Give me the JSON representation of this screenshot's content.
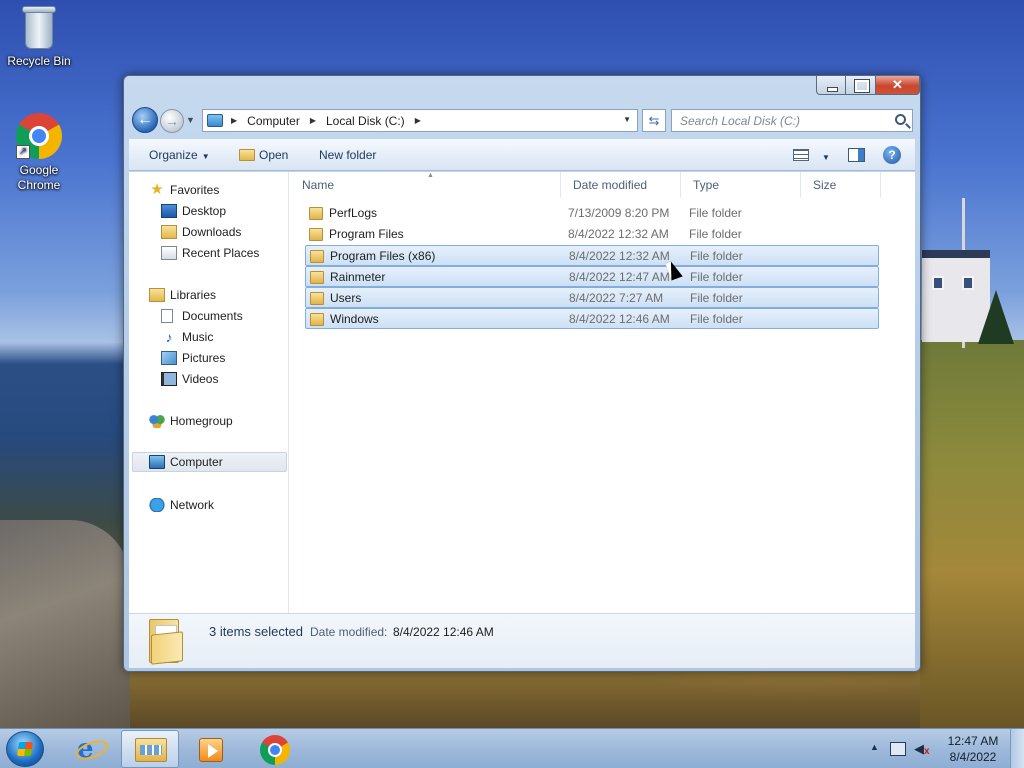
{
  "desktop": {
    "icons": [
      {
        "label": "Recycle Bin",
        "icon": "recycle-bin-icon"
      },
      {
        "label": "Google\nChrome",
        "icon": "chrome-icon"
      }
    ]
  },
  "window": {
    "address": {
      "crumbs": [
        "Computer",
        "Local Disk (C:)"
      ]
    },
    "search": {
      "placeholder": "Search Local Disk (C:)"
    },
    "toolbar": {
      "organize": "Organize",
      "open": "Open",
      "new_folder": "New folder"
    },
    "nav": {
      "favorites": "Favorites",
      "desktop": "Desktop",
      "downloads": "Downloads",
      "recent_places": "Recent Places",
      "libraries": "Libraries",
      "documents": "Documents",
      "music": "Music",
      "pictures": "Pictures",
      "videos": "Videos",
      "homegroup": "Homegroup",
      "computer": "Computer",
      "network": "Network"
    },
    "columns": {
      "name": "Name",
      "date": "Date modified",
      "type": "Type",
      "size": "Size"
    },
    "rows": [
      {
        "name": "PerfLogs",
        "date": "7/13/2009 8:20 PM",
        "type": "File folder",
        "selected": false
      },
      {
        "name": "Program Files",
        "date": "8/4/2022 12:32 AM",
        "type": "File folder",
        "selected": false
      },
      {
        "name": "Program Files (x86)",
        "date": "8/4/2022 12:32 AM",
        "type": "File folder",
        "selected": true
      },
      {
        "name": "Rainmeter",
        "date": "8/4/2022 12:47 AM",
        "type": "File folder",
        "selected": true
      },
      {
        "name": "Users",
        "date": "8/4/2022 7:27 AM",
        "type": "File folder",
        "selected": true
      },
      {
        "name": "Windows",
        "date": "8/4/2022 12:46 AM",
        "type": "File folder",
        "selected": true
      }
    ],
    "details": {
      "count": "3 items selected",
      "label": "Date modified:",
      "value": "8/4/2022 12:46 AM"
    }
  },
  "taskbar": {
    "clock": {
      "time": "12:47 AM",
      "date": "8/4/2022"
    }
  },
  "colors": {
    "selection_border": "#84acdd",
    "taskbar": "#9eb9da"
  }
}
